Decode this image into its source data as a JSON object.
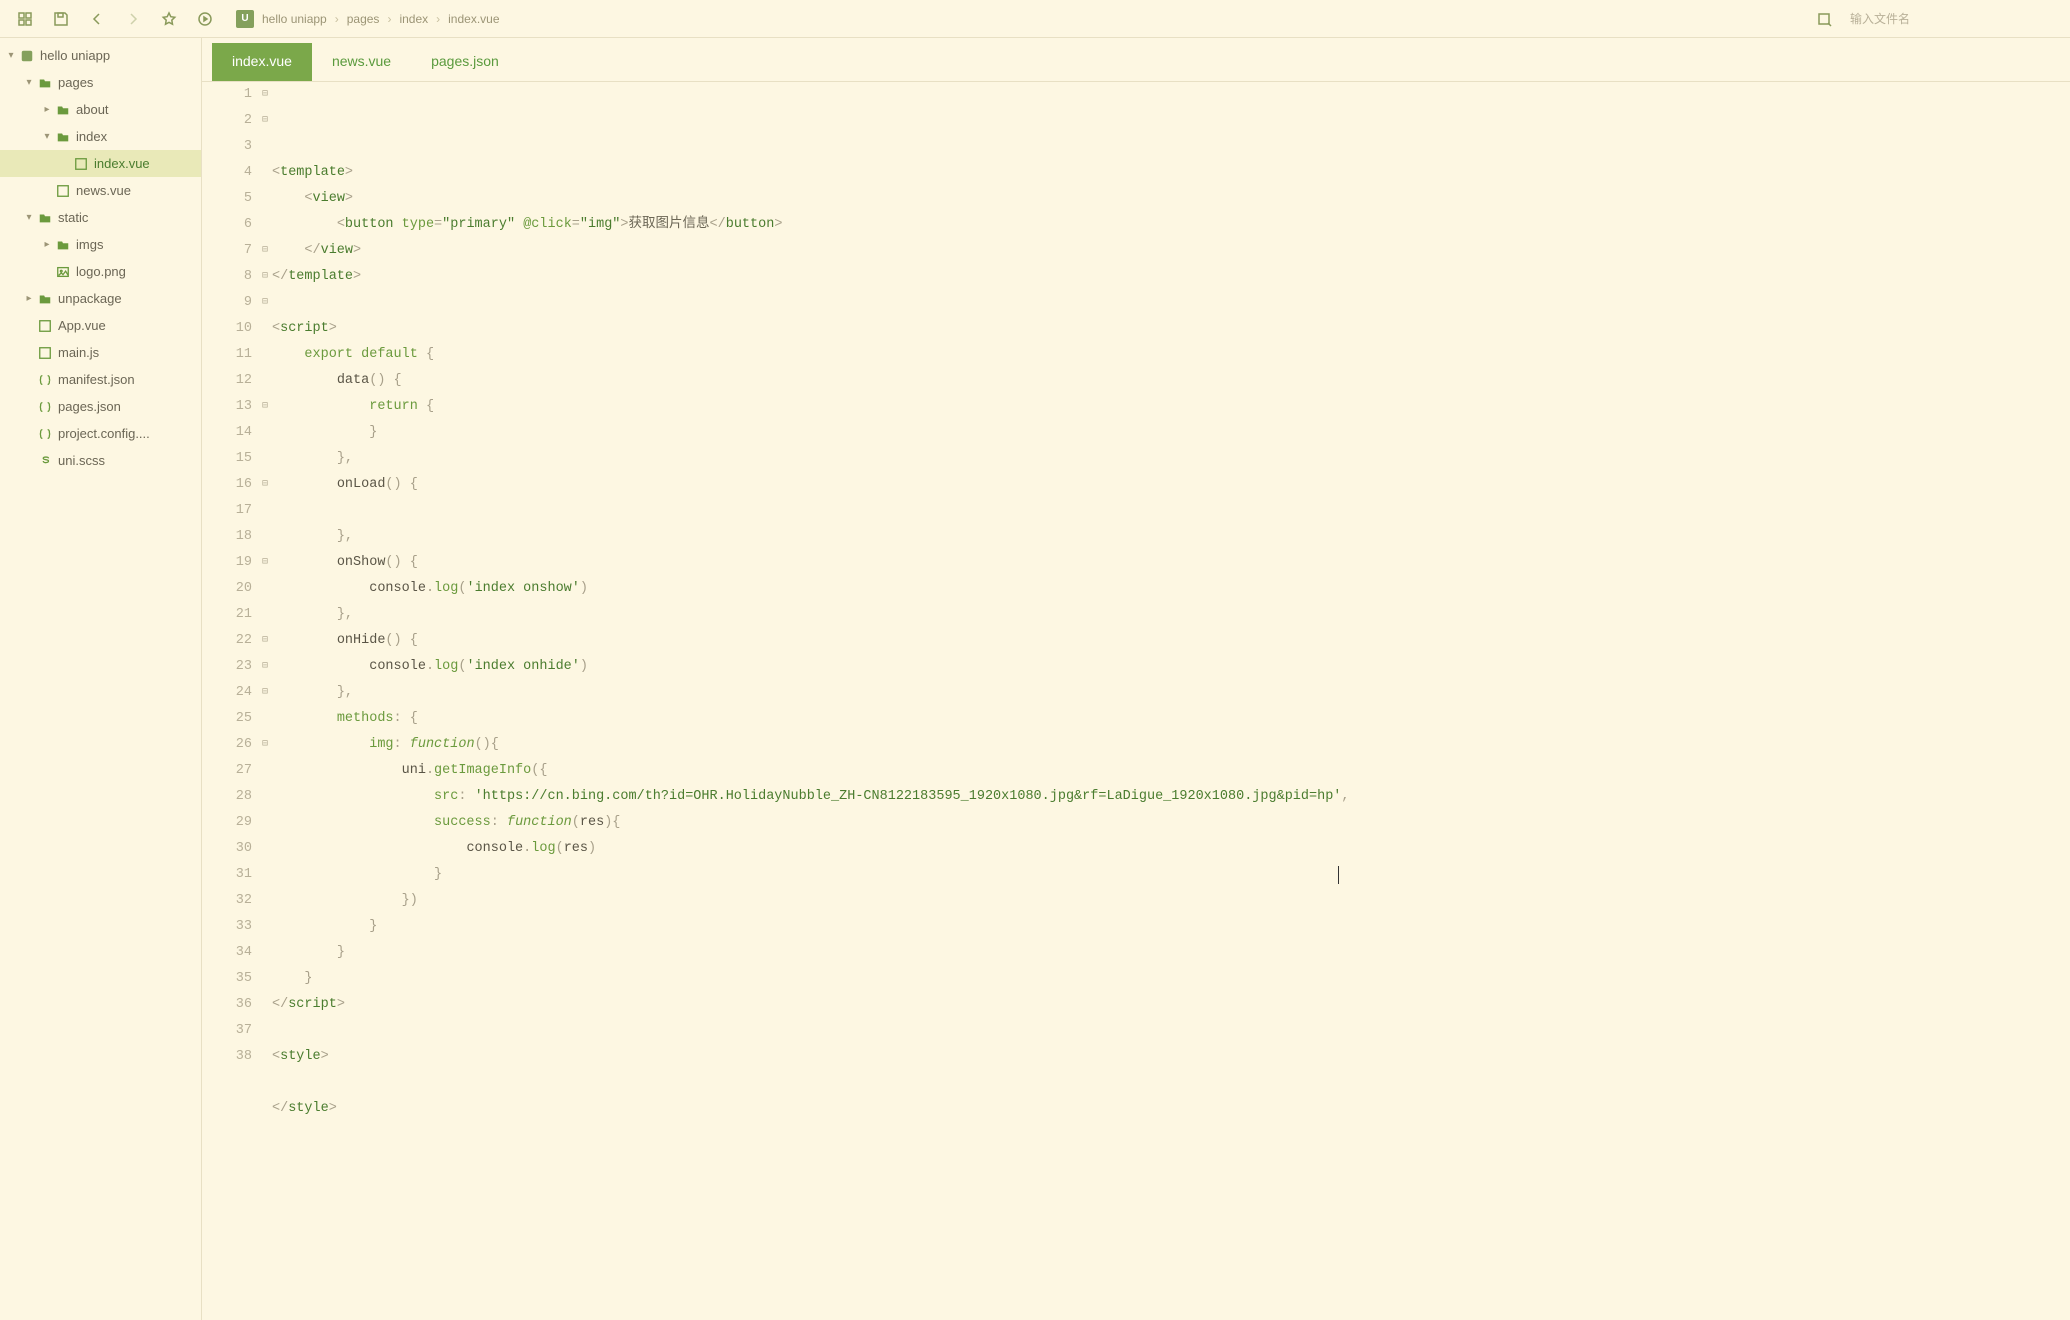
{
  "toolbar": {
    "search_placeholder": "输入文件名"
  },
  "breadcrumb": [
    "hello uniapp",
    "pages",
    "index",
    "index.vue"
  ],
  "tabs": [
    {
      "label": "index.vue",
      "active": true
    },
    {
      "label": "news.vue",
      "active": false
    },
    {
      "label": "pages.json",
      "active": false
    }
  ],
  "tree": [
    {
      "indent": 0,
      "chevron": "down",
      "icon": "project",
      "label": "hello uniapp"
    },
    {
      "indent": 1,
      "chevron": "down",
      "icon": "folder",
      "label": "pages"
    },
    {
      "indent": 2,
      "chevron": "right",
      "icon": "folder",
      "label": "about"
    },
    {
      "indent": 2,
      "chevron": "down",
      "icon": "folder",
      "label": "index"
    },
    {
      "indent": 3,
      "chevron": "",
      "icon": "vue",
      "label": "index.vue",
      "active": true
    },
    {
      "indent": 2,
      "chevron": "",
      "icon": "vue",
      "label": "news.vue"
    },
    {
      "indent": 1,
      "chevron": "down",
      "icon": "folder",
      "label": "static"
    },
    {
      "indent": 2,
      "chevron": "right",
      "icon": "folder",
      "label": "imgs"
    },
    {
      "indent": 2,
      "chevron": "",
      "icon": "image",
      "label": "logo.png"
    },
    {
      "indent": 1,
      "chevron": "right",
      "icon": "folder",
      "label": "unpackage"
    },
    {
      "indent": 1,
      "chevron": "",
      "icon": "vue",
      "label": "App.vue"
    },
    {
      "indent": 1,
      "chevron": "",
      "icon": "js",
      "label": "main.js"
    },
    {
      "indent": 1,
      "chevron": "",
      "icon": "json",
      "label": "manifest.json"
    },
    {
      "indent": 1,
      "chevron": "",
      "icon": "json",
      "label": "pages.json"
    },
    {
      "indent": 1,
      "chevron": "",
      "icon": "json",
      "label": "project.config...."
    },
    {
      "indent": 1,
      "chevron": "",
      "icon": "scss",
      "label": "uni.scss"
    }
  ],
  "code": {
    "lines": [
      {
        "n": 1,
        "fold": "⊟",
        "html": "<span class='t-punct'>&lt;</span><span class='t-tag'>template</span><span class='t-punct'>&gt;</span>"
      },
      {
        "n": 2,
        "fold": "⊟",
        "html": "    <span class='t-punct'>&lt;</span><span class='t-tag'>view</span><span class='t-punct'>&gt;</span>"
      },
      {
        "n": 3,
        "fold": "",
        "html": "        <span class='t-punct'>&lt;</span><span class='t-tag'>button</span> <span class='t-attr'>type</span><span class='t-punct'>=</span><span class='t-str'>\"primary\"</span> <span class='t-attr'>@click</span><span class='t-punct'>=</span><span class='t-str'>\"img\"</span><span class='t-punct'>&gt;</span><span class='t-text'>获取图片信息</span><span class='t-punct'>&lt;/</span><span class='t-tag'>button</span><span class='t-punct'>&gt;</span>"
      },
      {
        "n": 4,
        "fold": "",
        "html": "    <span class='t-punct'>&lt;/</span><span class='t-tag'>view</span><span class='t-punct'>&gt;</span>"
      },
      {
        "n": 5,
        "fold": "",
        "html": "<span class='t-punct'>&lt;/</span><span class='t-tag'>template</span><span class='t-punct'>&gt;</span>"
      },
      {
        "n": 6,
        "fold": "",
        "html": ""
      },
      {
        "n": 7,
        "fold": "⊟",
        "html": "<span class='t-punct'>&lt;</span><span class='t-tag'>script</span><span class='t-punct'>&gt;</span>"
      },
      {
        "n": 8,
        "fold": "⊟",
        "html": "    <span class='t-kw'>export</span> <span class='t-kw'>default</span> <span class='t-punct'>{</span>"
      },
      {
        "n": 9,
        "fold": "⊟",
        "html": "        <span class='t-name'>data</span><span class='t-punct'>() {</span>"
      },
      {
        "n": 10,
        "fold": "",
        "html": "            <span class='t-kw'>return</span> <span class='t-punct'>{</span>"
      },
      {
        "n": 11,
        "fold": "",
        "html": "            <span class='t-punct'>}</span>"
      },
      {
        "n": 12,
        "fold": "",
        "html": "        <span class='t-punct'>},</span>"
      },
      {
        "n": 13,
        "fold": "⊟",
        "html": "        <span class='t-name'>onLoad</span><span class='t-punct'>() {</span>"
      },
      {
        "n": 14,
        "fold": "",
        "html": ""
      },
      {
        "n": 15,
        "fold": "",
        "html": "        <span class='t-punct'>},</span>"
      },
      {
        "n": 16,
        "fold": "⊟",
        "html": "        <span class='t-name'>onShow</span><span class='t-punct'>() {</span>"
      },
      {
        "n": 17,
        "fold": "",
        "html": "            <span class='t-name'>console</span><span class='t-punct'>.</span><span class='t-prop'>log</span><span class='t-punct'>(</span><span class='t-str'>'index onshow'</span><span class='t-punct'>)</span>"
      },
      {
        "n": 18,
        "fold": "",
        "html": "        <span class='t-punct'>},</span>"
      },
      {
        "n": 19,
        "fold": "⊟",
        "html": "        <span class='t-name'>onHide</span><span class='t-punct'>() {</span>"
      },
      {
        "n": 20,
        "fold": "",
        "html": "            <span class='t-name'>console</span><span class='t-punct'>.</span><span class='t-prop'>log</span><span class='t-punct'>(</span><span class='t-str'>'index onhide'</span><span class='t-punct'>)</span>"
      },
      {
        "n": 21,
        "fold": "",
        "html": "        <span class='t-punct'>},</span>"
      },
      {
        "n": 22,
        "fold": "⊟",
        "html": "        <span class='t-prop'>methods</span><span class='t-punct'>: {</span>"
      },
      {
        "n": 23,
        "fold": "⊟",
        "html": "            <span class='t-prop'>img</span><span class='t-punct'>:</span> <span class='t-fn'>function</span><span class='t-punct'>(){</span>"
      },
      {
        "n": 24,
        "fold": "⊟",
        "html": "                <span class='t-name'>uni</span><span class='t-punct'>.</span><span class='t-prop'>getImageInfo</span><span class='t-punct'>({</span>"
      },
      {
        "n": 25,
        "fold": "",
        "html": "                    <span class='t-prop'>src</span><span class='t-punct'>:</span> <span class='t-str'>'https://cn.bing.com/th?id=OHR.HolidayNubble_ZH-CN8122183595_1920x1080.jpg&rf=LaDigue_1920x1080.jpg&pid=hp'</span><span class='t-punct'>,</span>"
      },
      {
        "n": 26,
        "fold": "⊟",
        "html": "                    <span class='t-prop'>success</span><span class='t-punct'>:</span> <span class='t-fn'>function</span><span class='t-punct'>(</span><span class='t-name'>res</span><span class='t-punct'>){</span>"
      },
      {
        "n": 27,
        "fold": "",
        "html": "                        <span class='t-name'>console</span><span class='t-punct'>.</span><span class='t-prop'>log</span><span class='t-punct'>(</span><span class='t-name'>res</span><span class='t-punct'>)</span>"
      },
      {
        "n": 28,
        "fold": "",
        "html": "                    <span class='t-punct'>}</span>"
      },
      {
        "n": 29,
        "fold": "",
        "html": "                <span class='t-punct'>})</span>"
      },
      {
        "n": 30,
        "fold": "",
        "html": "            <span class='t-punct'>}</span>"
      },
      {
        "n": 31,
        "fold": "",
        "html": "        <span class='t-punct'>}</span>"
      },
      {
        "n": 32,
        "fold": "",
        "html": "    <span class='t-punct'>}</span>"
      },
      {
        "n": 33,
        "fold": "",
        "html": "<span class='t-punct'>&lt;/</span><span class='t-tag'>script</span><span class='t-punct'>&gt;</span>"
      },
      {
        "n": 34,
        "fold": "",
        "html": ""
      },
      {
        "n": 35,
        "fold": "",
        "html": "<span class='t-punct'>&lt;</span><span class='t-tag'>style</span><span class='t-punct'>&gt;</span>"
      },
      {
        "n": 36,
        "fold": "",
        "html": ""
      },
      {
        "n": 37,
        "fold": "",
        "html": "<span class='t-punct'>&lt;/</span><span class='t-tag'>style</span><span class='t-punct'>&gt;</span>"
      },
      {
        "n": 38,
        "fold": "",
        "html": ""
      }
    ]
  }
}
